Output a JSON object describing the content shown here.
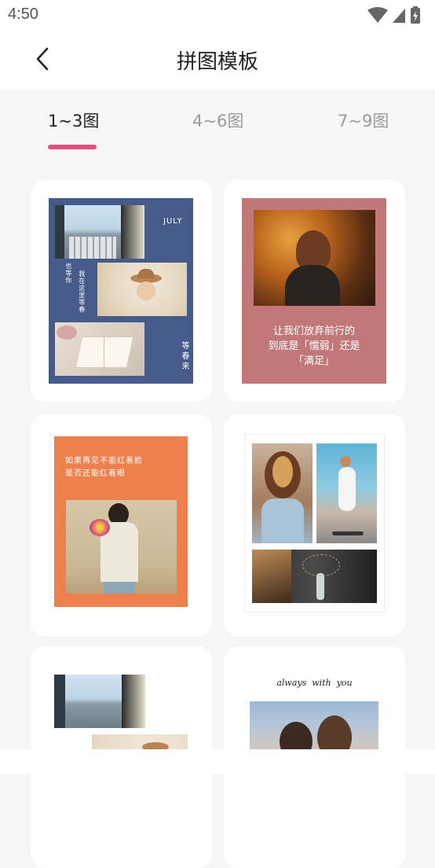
{
  "status": {
    "time": "4:50"
  },
  "header": {
    "title": "拼图模板",
    "back_icon": "chevron-left-icon"
  },
  "tabs": [
    {
      "label": "1~3图",
      "active": true
    },
    {
      "label": "4~6图",
      "active": false
    },
    {
      "label": "7~9图",
      "active": false
    }
  ],
  "accent": "#e0507f",
  "templates": [
    {
      "name": "template-1",
      "month": "JULY",
      "line_a": "也等你",
      "line_b": "我在这里等春",
      "line_c": "等春来",
      "bg": "#465b89"
    },
    {
      "name": "template-2",
      "caption_1": "让我们放弃前行的",
      "caption_2": "到底是「懦弱」还是",
      "caption_3": "「满足」",
      "bg": "#c27879"
    },
    {
      "name": "template-3",
      "caption_1": "如果再见不能红着脸",
      "caption_2": "是否还能红着眼",
      "bg": "#ee804d"
    },
    {
      "name": "template-4",
      "bg": "#ffffff"
    },
    {
      "name": "template-5",
      "bg": "#ffffff"
    },
    {
      "name": "template-6",
      "caption": "always  with  you",
      "bg": "#ffffff"
    }
  ]
}
